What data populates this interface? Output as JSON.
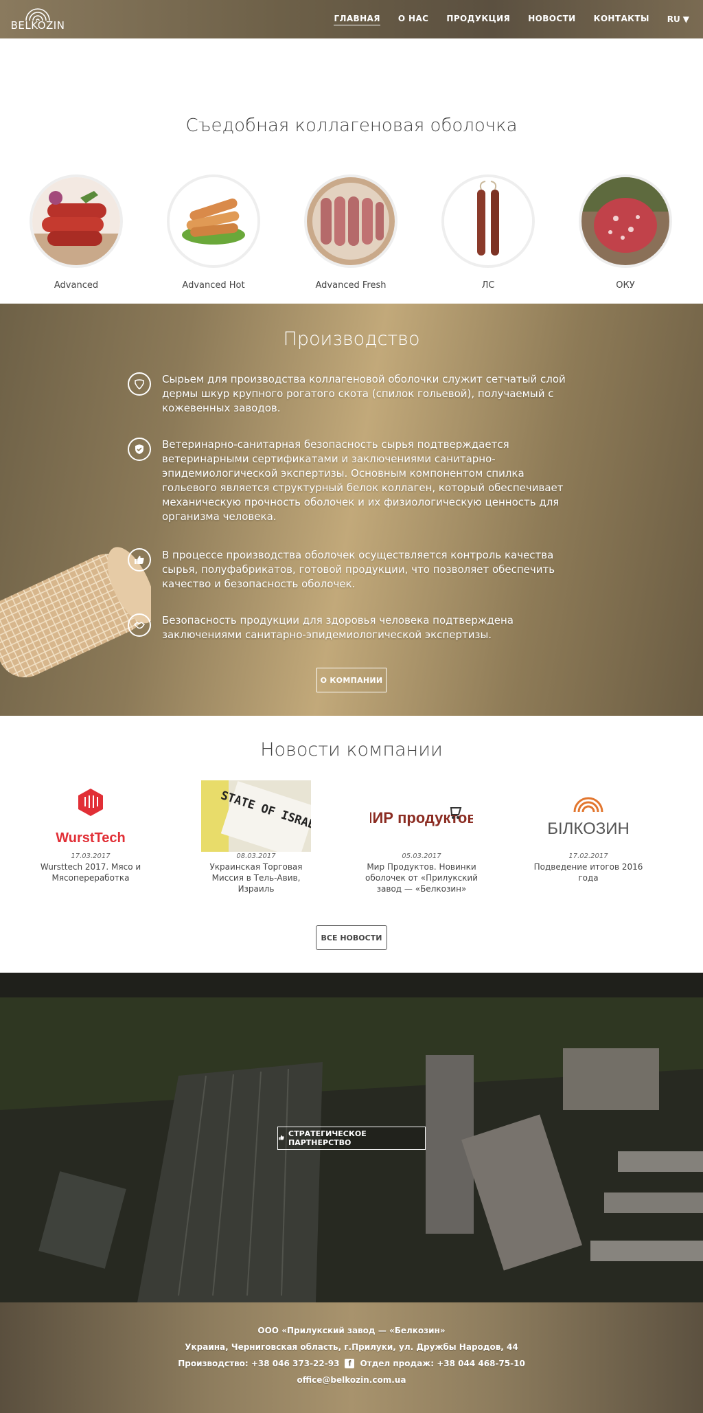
{
  "header": {
    "logo_text": "BELKOZIN",
    "nav": [
      {
        "label": "ГЛАВНАЯ",
        "active": true
      },
      {
        "label": "О НАС"
      },
      {
        "label": "ПРОДУКЦИЯ"
      },
      {
        "label": "НОВОСТИ"
      },
      {
        "label": "КОНТАКТЫ"
      }
    ],
    "lang": "RU"
  },
  "casings": {
    "title": "Съедобная коллагеновая оболочка",
    "items": [
      {
        "label": "Advanced"
      },
      {
        "label": "Advanced Hot"
      },
      {
        "label": "Advanced Fresh"
      },
      {
        "label": "ЛС"
      },
      {
        "label": "ОКУ"
      }
    ]
  },
  "production": {
    "title": "Производство",
    "items": [
      {
        "icon": "leather-icon",
        "text": "Сырьем для производства коллагеновой оболочки служит сетчатый слой дермы шкур крупного рогатого скота (спилок гольевой), получаемый с кожевенных заводов."
      },
      {
        "icon": "shield-check-icon",
        "text": "Ветеринарно-санитарная безопасность сырья подтверждается ветеринарными сертификатами и заключениями санитарно-эпидемиологической экспертизы. Основным компонентом спилка гольевого является структурный белок коллаген, который обеспечивает механическую прочность оболочек и их физиологическую ценность для организма человека."
      },
      {
        "icon": "thumbs-up-icon",
        "text": "В процессе производства оболочек осуществляется контроль качества сырья, полуфабрикатов, готовой продукции, что позволяет обеспечить качество и безопасность оболочек."
      },
      {
        "icon": "handshake-icon",
        "text": "Безопасность продукции для здоровья человека подтверждена заключениями санитарно-эпидемиологической экспертизы."
      }
    ],
    "button": "О КОМПАНИИ"
  },
  "news": {
    "title": "Новости компании",
    "items": [
      {
        "date": "17.03.2017",
        "title": "Wursttech 2017. Мясо и Мясопереработка",
        "logo_text": "WurstTech"
      },
      {
        "date": "08.03.2017",
        "title": "Украинская Торговая Миссия в Тель-Авив, Израиль",
        "logo_text": "STATE OF ISRAEL"
      },
      {
        "date": "05.03.2017",
        "title": "Мир Продуктов. Новинки оболочек от «Прилукский завод — «Белкозин»",
        "logo_text": "МИР продуктов"
      },
      {
        "date": "17.02.2017",
        "title": "Подведение итогов 2016 года",
        "logo_text": "БІЛКОЗИН"
      }
    ],
    "button": "ВСЕ НОВОСТИ"
  },
  "aerial": {
    "button": "СТРАТЕГИЧЕСКОЕ ПАРТНЕРСТВО"
  },
  "footer": {
    "company": "ООО «Прилукский завод — «Белкозин»",
    "address": "Украина, Черниговская область, г.Прилуки, ул. Дружбы Народов, 44",
    "production_phone": "Производство: +38 046 373-22-93",
    "sales_phone": "Отдел продаж: +38 044 468-75-10",
    "email": "office@belkozin.com.ua"
  }
}
